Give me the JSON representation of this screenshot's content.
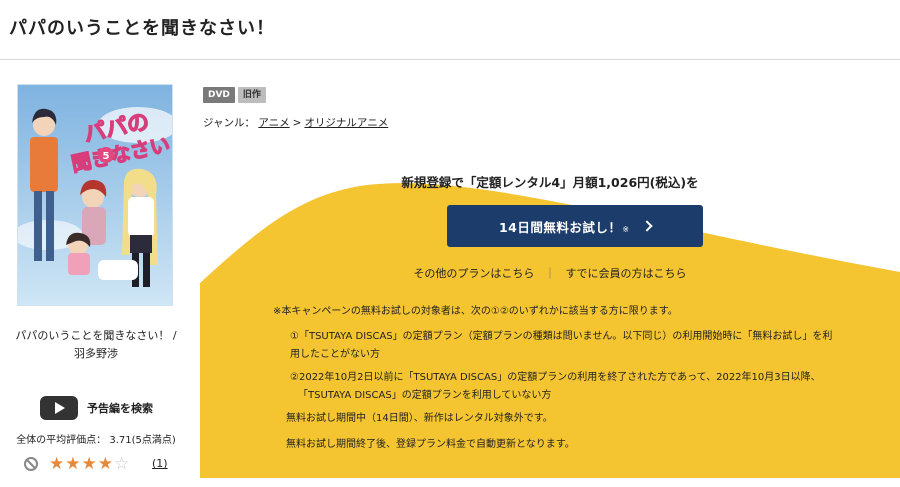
{
  "page": {
    "title": "パパのいうことを聞きなさい！"
  },
  "cover": {
    "alt": "パパのいうことを聞きなさい！ 5"
  },
  "work": {
    "title": "パパのいうことを聞きなさい！ /",
    "author": "羽多野渉"
  },
  "trailer": {
    "label": "予告編を検索",
    "icon": "play-icon"
  },
  "rating": {
    "label": "全体の平均評価点：",
    "value": "3.71",
    "scale": "(5点満点)",
    "stars_filled": 4,
    "stars_total": 5,
    "review_count": "(1)",
    "colors": {
      "filled": "#e8893a",
      "empty": "#c9c9c9"
    }
  },
  "badges": [
    "DVD",
    "旧作"
  ],
  "genre": {
    "label": "ジャンル：",
    "items": [
      "アニメ",
      "オリジナルアニメ"
    ],
    "separator": ">"
  },
  "promo": {
    "headline": "新規登録で「定額レンタル4」月額1,026円(税込)を",
    "button_label": "14日間無料お試し！",
    "button_mark": "※",
    "other_plans": "その他のプランはこちら",
    "divider": "｜",
    "member_login": "すでに会員の方はこちら",
    "colors": {
      "button": "#1c3d6b",
      "background": "#f5c531"
    }
  },
  "notes": {
    "title": "※本キャンペーンの無料お試しの対象者は、次の①②のいずれかに該当する方に限ります。",
    "item1_line1": "①「TSUTAYA DISCAS」の定額プラン（定額プランの種類は問いません。以下同じ）の利用開始時に「無料お試し」を利",
    "item1_line2": "用したことがない方",
    "item2_line1": "②2022年10月2日以前に「TSUTAYA DISCAS」の定額プランの利用を終了された方であって、2022年10月3日以降、",
    "item2_line2": "「TSUTAYA DISCAS」の定額プランを利用していない方",
    "trial_period": "無料お試し期間中（14日間）、新作はレンタル対象外です。",
    "auto_renew": "無料お試し期間終了後、登録プラン料金で自動更新となります。"
  }
}
